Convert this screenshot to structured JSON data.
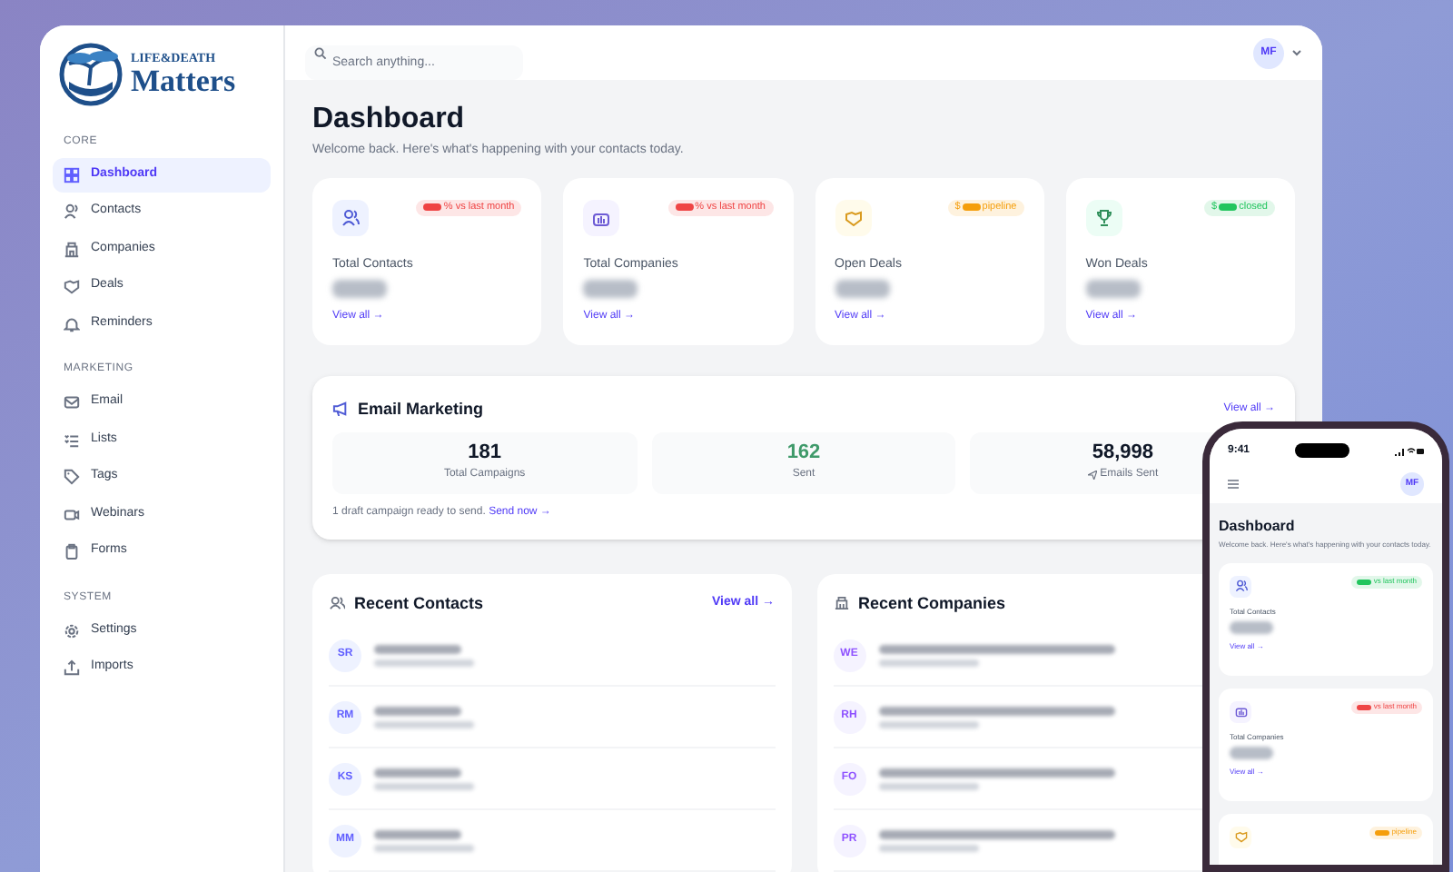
{
  "logo": {
    "line1": "LIFE&DEATH",
    "line2": "Matters"
  },
  "search": {
    "placeholder": "Search anything..."
  },
  "user": {
    "initials": "MF"
  },
  "sidebar": {
    "sections": [
      {
        "title": "CORE",
        "items": [
          {
            "label": "Dashboard",
            "selected": true
          },
          {
            "label": "Contacts",
            "selected": false
          },
          {
            "label": "Companies",
            "selected": false
          },
          {
            "label": "Deals",
            "selected": false
          },
          {
            "label": "Reminders",
            "selected": false
          }
        ]
      },
      {
        "title": "MARKETING",
        "items": [
          {
            "label": "Email",
            "selected": false
          },
          {
            "label": "Lists",
            "selected": false
          },
          {
            "label": "Tags",
            "selected": false
          },
          {
            "label": "Webinars",
            "selected": false
          },
          {
            "label": "Forms",
            "selected": false
          }
        ]
      },
      {
        "title": "SYSTEM",
        "items": [
          {
            "label": "Settings",
            "selected": false
          },
          {
            "label": "Imports",
            "selected": false
          }
        ]
      }
    ]
  },
  "page": {
    "title": "Dashboard",
    "subtitle": "Welcome back. Here's what's happening with your contacts today."
  },
  "stat_cards": [
    {
      "label": "Total Contacts",
      "badge_after": "% vs last month",
      "color": "#ef4444",
      "link": "View all →"
    },
    {
      "label": "Total Companies",
      "badge_after": "% vs last month",
      "color": "#ef4444",
      "link": "View all →"
    },
    {
      "label": "Open Deals",
      "badge_before": "$",
      "badge_after": "pipeline",
      "color": "#f59e0b",
      "link": "View all →"
    },
    {
      "label": "Won Deals",
      "badge_before": "$",
      "badge_after": "closed",
      "color": "#22c55e",
      "link": "View all →"
    }
  ],
  "email_marketing": {
    "title": "Email Marketing",
    "link": "View all →",
    "stats": [
      {
        "value": "181",
        "label": "Total Campaigns",
        "kind": "plain"
      },
      {
        "value": "162",
        "label": "Sent",
        "kind": "success"
      },
      {
        "value": "58,998",
        "label": "Emails Sent",
        "kind": "send"
      }
    ],
    "note": "1 draft campaign ready to send.",
    "note_link": "Send now →"
  },
  "recent_contacts": {
    "title": "Recent Contacts",
    "link": "View all →",
    "rows": [
      {
        "initials": "SR"
      },
      {
        "initials": "RM"
      },
      {
        "initials": "KS"
      },
      {
        "initials": "MM"
      }
    ]
  },
  "recent_companies": {
    "title": "Recent Companies",
    "rows": [
      {
        "initials": "WE"
      },
      {
        "initials": "RH"
      },
      {
        "initials": "FO"
      },
      {
        "initials": "PR"
      }
    ]
  },
  "phone": {
    "time": "9:41",
    "initials": "MF",
    "title": "Dashboard",
    "subtitle": "Welcome back. Here's what's happening with your contacts today.",
    "cards": [
      {
        "label": "Total Contacts",
        "badge": "vs last month",
        "color": "#22c55e",
        "link": "View all →"
      },
      {
        "label": "Total Companies",
        "badge": "vs last month",
        "color": "#ef4444",
        "link": "View all →"
      },
      {
        "badge": "pipeline",
        "color": "#f59e0b"
      }
    ]
  }
}
